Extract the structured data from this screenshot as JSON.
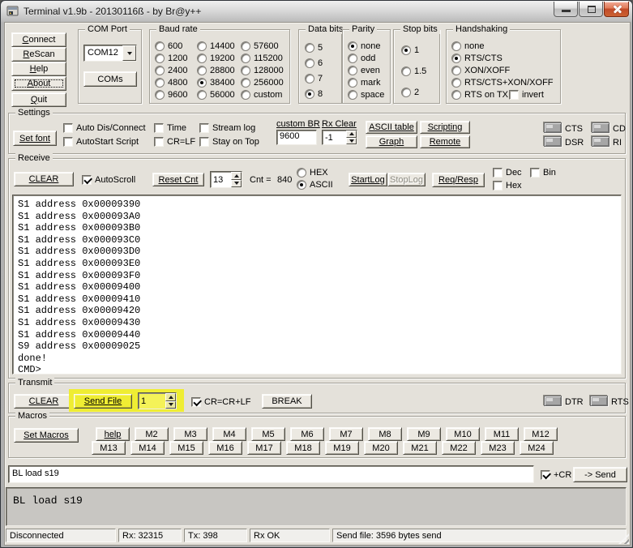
{
  "window": {
    "title": "Terminal v1.9b - 20130116ß - by Br@y++"
  },
  "nav": {
    "buttons": [
      {
        "label": "Connect"
      },
      {
        "label": "ReScan"
      },
      {
        "label": "Help"
      },
      {
        "label": "About"
      },
      {
        "label": "Quit"
      }
    ]
  },
  "com_port": {
    "label": "COM Port",
    "selected": "COM12",
    "coms": "COMs"
  },
  "baud": {
    "label": "Baud rate",
    "options": [
      "600",
      "1200",
      "2400",
      "4800",
      "9600",
      "14400",
      "19200",
      "28800",
      "38400",
      "56000",
      "57600",
      "115200",
      "128000",
      "256000",
      "custom"
    ],
    "selected": "38400"
  },
  "data_bits": {
    "label": "Data bits",
    "options": [
      "5",
      "6",
      "7",
      "8"
    ],
    "selected": "8"
  },
  "parity": {
    "label": "Parity",
    "options": [
      "none",
      "odd",
      "even",
      "mark",
      "space"
    ],
    "selected": "none"
  },
  "stop_bits": {
    "label": "Stop bits",
    "options": [
      "1",
      "1.5",
      "2"
    ],
    "selected": "1"
  },
  "handshaking": {
    "label": "Handshaking",
    "options": [
      "none",
      "RTS/CTS",
      "XON/XOFF",
      "RTS/CTS+XON/XOFF",
      "RTS on TX"
    ],
    "selected": "RTS/CTS",
    "invert": {
      "label": "invert",
      "checked": false
    }
  },
  "settings": {
    "label": "Settings",
    "set_font": "Set font",
    "checks": [
      {
        "label": "Auto Dis/Connect",
        "checked": false
      },
      {
        "label": "AutoStart Script",
        "checked": false
      },
      {
        "label": "Time",
        "checked": false
      },
      {
        "label": "CR=LF",
        "checked": false
      },
      {
        "label": "Stream log",
        "checked": false
      },
      {
        "label": "Stay on Top",
        "checked": false
      }
    ],
    "custom_br": {
      "label": "custom BR",
      "value": "9600"
    },
    "rx_clear": {
      "label": "Rx Clear",
      "value": "-1"
    },
    "ascii_table": "ASCII table",
    "scripting": "Scripting",
    "graph": "Graph",
    "remote": "Remote",
    "leds": [
      "CTS",
      "CD",
      "DSR",
      "RI"
    ]
  },
  "receive": {
    "label": "Receive",
    "clear": "CLEAR",
    "autoscroll": {
      "label": "AutoScroll",
      "checked": true
    },
    "reset_cnt": "Reset Cnt",
    "counter": "13",
    "cnt_label": "Cnt =",
    "cnt_value": "840",
    "modes": [
      {
        "label": "HEX",
        "selected": false
      },
      {
        "label": "ASCII",
        "selected": true
      }
    ],
    "startlog": "StartLog",
    "stoplog": "StopLog",
    "reqresp": "Req/Resp",
    "views": [
      {
        "label": "Dec",
        "checked": false
      },
      {
        "label": "Hex",
        "checked": false
      },
      {
        "label": "Bin",
        "checked": false
      }
    ],
    "terminal_text": "S1 address 0x00009390\nS1 address 0x000093A0\nS1 address 0x000093B0\nS1 address 0x000093C0\nS1 address 0x000093D0\nS1 address 0x000093E0\nS1 address 0x000093F0\nS1 address 0x00009400\nS1 address 0x00009410\nS1 address 0x00009420\nS1 address 0x00009430\nS1 address 0x00009440\nS9 address 0x00009025\ndone!\nCMD>"
  },
  "transmit": {
    "label": "Transmit",
    "clear": "CLEAR",
    "send_file": "Send File",
    "count": "1",
    "cr_crlf": {
      "label": "CR=CR+LF",
      "checked": true
    },
    "break": "BREAK",
    "leds": [
      "DTR",
      "RTS"
    ]
  },
  "macros": {
    "label": "Macros",
    "set_macros": "Set Macros",
    "row1": [
      "help",
      "M2",
      "M3",
      "M4",
      "M5",
      "M6",
      "M7",
      "M8",
      "M9",
      "M10",
      "M11",
      "M12"
    ],
    "row2": [
      "M13",
      "M14",
      "M15",
      "M16",
      "M17",
      "M18",
      "M19",
      "M20",
      "M21",
      "M22",
      "M23",
      "M24"
    ]
  },
  "command": {
    "value": "BL load s19",
    "cr": {
      "label": "+CR",
      "checked": true
    },
    "send": "-> Send"
  },
  "history": {
    "text": "BL load s19"
  },
  "status": {
    "panels": [
      "Disconnected",
      "Rx: 32315",
      "Tx: 398",
      "Rx OK",
      "Send file: 3596 bytes send"
    ]
  },
  "colors": {
    "highlight": "#efed33",
    "close_red": "#c14a28",
    "client_bg": "#e4e1da"
  }
}
